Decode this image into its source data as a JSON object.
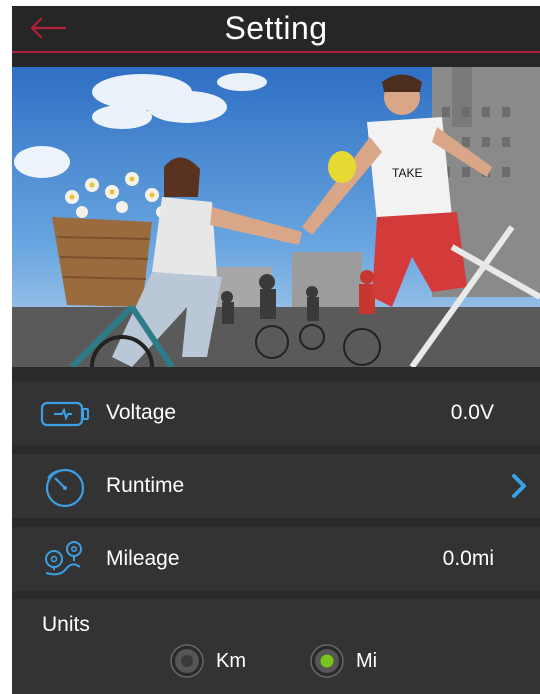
{
  "header": {
    "title": "Setting"
  },
  "rows": {
    "voltage": {
      "label": "Voltage",
      "value": "0.0V",
      "icon": "battery-icon"
    },
    "runtime": {
      "label": "Runtime",
      "icon": "stopwatch-icon",
      "chevron": "chevron-right-icon"
    },
    "mileage": {
      "label": "Mileage",
      "value": "0.0mi",
      "icon": "location-pins-icon"
    }
  },
  "units": {
    "title": "Units",
    "options": [
      {
        "label": "Km",
        "selected": false
      },
      {
        "label": "Mi",
        "selected": true
      }
    ]
  },
  "colors": {
    "accent_red": "#b0213a",
    "accent_blue": "#3ca0e6",
    "radio_selected": "#79c51e",
    "panel_bg": "#333333",
    "app_bg": "#262626"
  }
}
